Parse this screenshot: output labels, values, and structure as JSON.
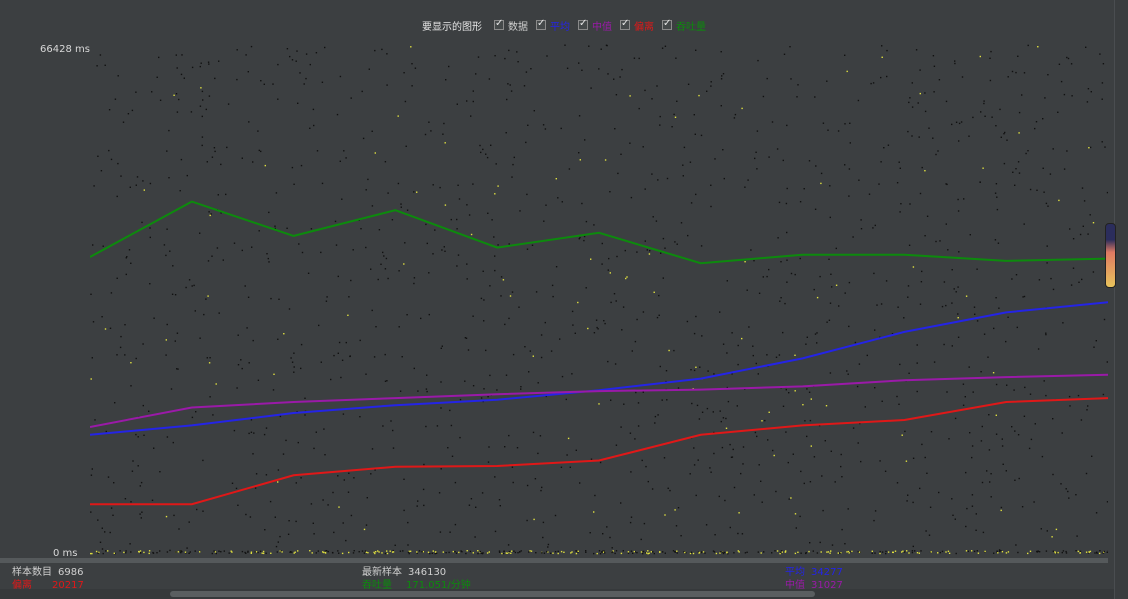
{
  "legend": {
    "title": "要显示的图形",
    "items": [
      {
        "label": "数据",
        "color": "#d8d8d8"
      },
      {
        "label": "平均",
        "color": "#2424e6"
      },
      {
        "label": "中值",
        "color": "#9a1aa8"
      },
      {
        "label": "偏离",
        "color": "#e01818"
      },
      {
        "label": "吞吐量",
        "color": "#0d8a0d"
      }
    ]
  },
  "axis": {
    "ymax_label": "66428  ms",
    "ymin_label": "0  ms"
  },
  "stats": {
    "samples_label": "样本数目",
    "samples_value": "6986",
    "latest_label": "最新样本",
    "latest_value": "346130",
    "average_label": "平均",
    "average_value": "34277",
    "deviation_label": "偏离",
    "deviation_value": "20217",
    "throughput_label": "吞吐量",
    "throughput_value": "171.051/分钟",
    "median_label": "中值",
    "median_value": "31027"
  },
  "colors": {
    "background": "#3c3f41",
    "data": "#111111",
    "data_highlight": "#e0e040",
    "average": "#2424e6",
    "median": "#9a1aa8",
    "deviation": "#e01818",
    "throughput": "#0d8a0d"
  },
  "chart_data": {
    "type": "scatter",
    "title": "",
    "ylim": [
      0,
      66428
    ],
    "yunit": "ms",
    "x": [
      0,
      0.1,
      0.2,
      0.3,
      0.4,
      0.5,
      0.6,
      0.7,
      0.8,
      0.9,
      1.0
    ],
    "series": [
      {
        "name": "平均",
        "values": [
          15800,
          17000,
          18600,
          19600,
          20300,
          21500,
          23000,
          25600,
          29000,
          31500,
          32800
        ]
      },
      {
        "name": "中值",
        "values": [
          16800,
          19300,
          20000,
          20500,
          21000,
          21400,
          21600,
          22000,
          22800,
          23200,
          23500
        ]
      },
      {
        "name": "偏离",
        "values": [
          6900,
          6900,
          10600,
          11700,
          11800,
          12500,
          15800,
          17000,
          17700,
          20000,
          20500
        ]
      },
      {
        "name": "吞吐量",
        "values": [
          38600,
          45700,
          41300,
          44600,
          39800,
          41700,
          37800,
          38900,
          38900,
          38100,
          38400
        ]
      }
    ]
  }
}
